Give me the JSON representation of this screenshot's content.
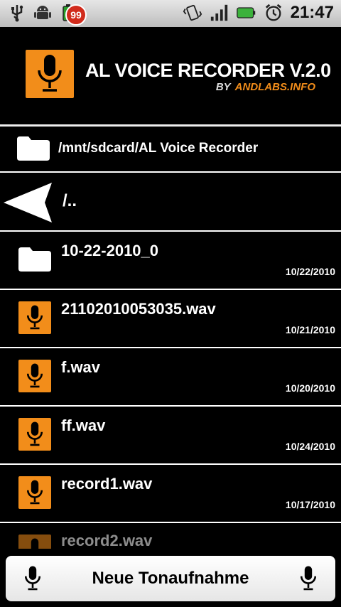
{
  "status_bar": {
    "notification_count": "99",
    "time": "21:47",
    "icons": [
      "usb-icon",
      "android-icon",
      "battery-small-icon",
      "vibrate-icon",
      "signal-icon",
      "battery-icon",
      "alarm-icon"
    ]
  },
  "header": {
    "title": "AL VOICE RECORDER V.2.0",
    "by_label": "BY",
    "by_link": "ANDLABS.INFO"
  },
  "path": {
    "current": "/mnt/sdcard/AL Voice Recorder"
  },
  "parent": {
    "label": "/.."
  },
  "files": [
    {
      "name": "10-22-2010_0",
      "date": "10/22/2010",
      "type": "folder"
    },
    {
      "name": "21102010053035.wav",
      "date": "10/21/2010",
      "type": "audio"
    },
    {
      "name": "f.wav",
      "date": "10/20/2010",
      "type": "audio"
    },
    {
      "name": "ff.wav",
      "date": "10/24/2010",
      "type": "audio"
    },
    {
      "name": "record1.wav",
      "date": "10/17/2010",
      "type": "audio"
    },
    {
      "name": "record2.wav",
      "date": "",
      "type": "audio"
    }
  ],
  "bottom": {
    "new_recording_label": "Neue Tonaufnahme"
  },
  "colors": {
    "accent": "#f28d1a",
    "background": "#000000",
    "badge": "#d12b1c"
  }
}
